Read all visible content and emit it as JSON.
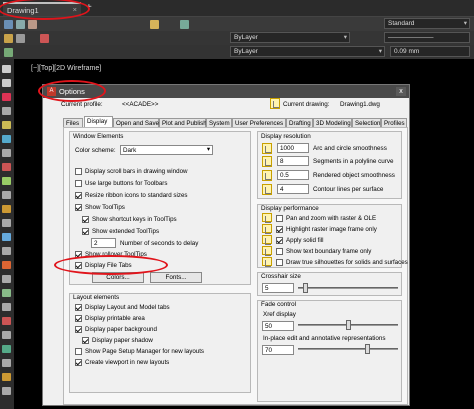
{
  "file_tab": {
    "title": "Drawing1",
    "close": "×",
    "new_tab": "+"
  },
  "ribbon": {
    "style_combo": "Standard",
    "layer_combo1": "ByLayer",
    "layer_combo2": "ByLayer",
    "lineweight_combo": "0.09 mm"
  },
  "viewport": {
    "label": "[−][Top][2D Wireframe]"
  },
  "dialog": {
    "title": "Options",
    "close": "x",
    "current_profile_label": "Current profile:",
    "current_profile_value": "<<ACADE>>",
    "current_drawing_label": "Current drawing:",
    "current_drawing_value": "Drawing1.dwg",
    "tabs": [
      "Files",
      "Display",
      "Open and Save",
      "Plot and Publish",
      "System",
      "User Preferences",
      "Drafting",
      "3D Modeling",
      "Selection",
      "Profiles"
    ],
    "active_tab": "Display",
    "window_elements": {
      "title": "Window Elements",
      "color_scheme_label": "Color scheme:",
      "color_scheme_value": "Dark",
      "checkboxes": [
        {
          "label": "Display scroll bars in drawing window",
          "checked": false
        },
        {
          "label": "Use large buttons for Toolbars",
          "checked": false
        },
        {
          "label": "Resize ribbon icons to standard sizes",
          "checked": true
        },
        {
          "label": "Show ToolTips",
          "checked": true
        },
        {
          "label": "Show shortcut keys in ToolTips",
          "checked": true
        },
        {
          "label": "Show extended ToolTips",
          "checked": true
        }
      ],
      "delay_value": "2",
      "delay_label": "Number of seconds to delay",
      "rollover_label": "Show rollover ToolTips",
      "rollover_checked": true,
      "file_tabs_label": "Display File Tabs",
      "file_tabs_checked": true,
      "colors_button": "Colors...",
      "fonts_button": "Fonts..."
    },
    "layout_elements": {
      "title": "Layout elements",
      "checkboxes": [
        {
          "label": "Display Layout and Model tabs",
          "checked": true
        },
        {
          "label": "Display printable area",
          "checked": true
        },
        {
          "label": "Display paper background",
          "checked": true
        },
        {
          "label": "Display paper shadow",
          "checked": true
        },
        {
          "label": "Show Page Setup Manager for new layouts",
          "checked": false
        },
        {
          "label": "Create viewport in new layouts",
          "checked": true
        }
      ]
    },
    "display_resolution": {
      "title": "Display resolution",
      "rows": [
        {
          "value": "1000",
          "label": "Arc and circle smoothness"
        },
        {
          "value": "8",
          "label": "Segments in a polyline curve"
        },
        {
          "value": "0.5",
          "label": "Rendered object smoothness"
        },
        {
          "value": "4",
          "label": "Contour lines per surface"
        }
      ]
    },
    "display_performance": {
      "title": "Display performance",
      "checkboxes": [
        {
          "label": "Pan and zoom with raster & OLE",
          "checked": false
        },
        {
          "label": "Highlight raster image frame only",
          "checked": true
        },
        {
          "label": "Apply solid fill",
          "checked": true
        },
        {
          "label": "Show text boundary frame only",
          "checked": false
        },
        {
          "label": "Draw true silhouettes for solids and surfaces",
          "checked": false
        }
      ]
    },
    "crosshair": {
      "title": "Crosshair size",
      "value": "5",
      "slider_fraction": 0.05
    },
    "fade": {
      "title": "Fade control",
      "xref_label": "Xref display",
      "xref_value": "50",
      "xref_fraction": 0.5,
      "inplace_label": "In-place edit and annotative representations",
      "inplace_value": "70",
      "inplace_fraction": 0.7
    }
  }
}
